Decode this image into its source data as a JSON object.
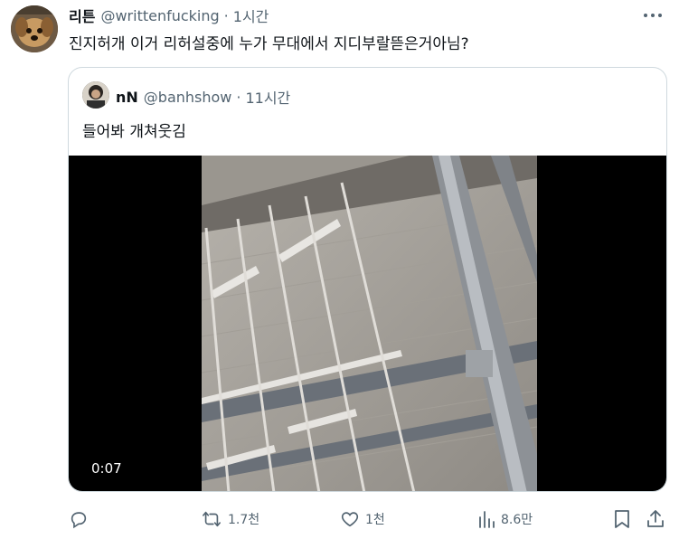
{
  "tweet": {
    "display_name": "리튼",
    "handle": "@writtenfucking",
    "separator": "·",
    "time": "1시간",
    "more_label": "···",
    "text": "진지허개 이거 리허설중에 누가 무대에서 지디부랄뜯은거아님?"
  },
  "quote": {
    "display_name": "nN",
    "handle": "@banhshow",
    "separator": "·",
    "time": "11시간",
    "text": "들어봐 개쳐웃김",
    "video_time": "0:07"
  },
  "actions": {
    "reply_count": "",
    "retweet_count": "1.7천",
    "like_count": "1천",
    "views_count": "8.6만"
  },
  "icons": {
    "reply": "reply-icon",
    "retweet": "retweet-icon",
    "like": "heart-icon",
    "views": "views-icon",
    "bookmark": "bookmark-icon",
    "share": "share-icon",
    "more": "more-icon"
  },
  "colors": {
    "text_primary": "#0f1419",
    "text_secondary": "#536471",
    "border": "#cfd9de"
  }
}
